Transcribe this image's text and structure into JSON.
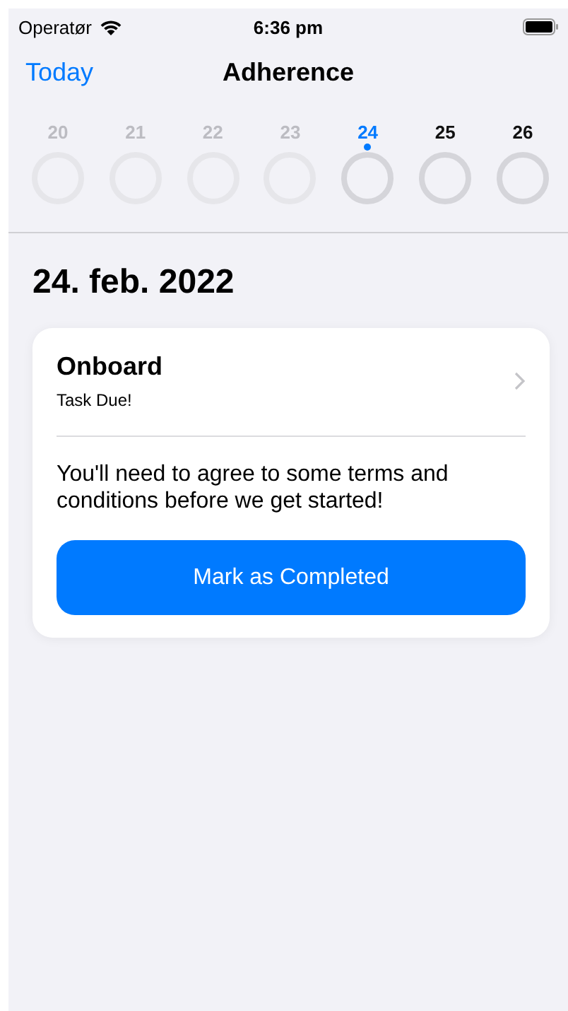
{
  "status_bar": {
    "carrier": "Operatør",
    "time": "6:36 pm"
  },
  "nav": {
    "back": "Today",
    "title": "Adherence"
  },
  "days": [
    {
      "label": "20",
      "past": true,
      "selected": false
    },
    {
      "label": "21",
      "past": true,
      "selected": false
    },
    {
      "label": "22",
      "past": true,
      "selected": false
    },
    {
      "label": "23",
      "past": true,
      "selected": false
    },
    {
      "label": "24",
      "past": false,
      "selected": true
    },
    {
      "label": "25",
      "past": false,
      "selected": false
    },
    {
      "label": "26",
      "past": false,
      "selected": false
    }
  ],
  "date_heading": "24. feb. 2022",
  "tasks": [
    {
      "title": "Onboard",
      "subtitle": "Task Due!",
      "description": "You'll need to agree to some terms and conditions before we get started!",
      "button": "Mark as Completed"
    }
  ]
}
